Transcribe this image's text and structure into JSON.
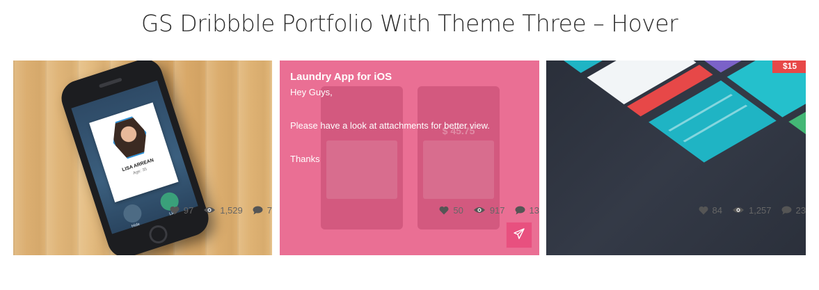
{
  "page": {
    "title": "GS Dribbble Portfolio With Theme Three – Hover"
  },
  "cards": [
    {
      "image": {
        "profile_name": "LISA ARREAN",
        "profile_age": "Age: 35",
        "hide_label": "Hide",
        "like_label": "Like"
      },
      "stats": {
        "likes": "97",
        "views": "1,529",
        "comments": "7"
      }
    },
    {
      "overlay": {
        "title": "Laundry App for iOS",
        "line1": "Hey Guys,",
        "line2": "Please have a look at attachments for better view.",
        "line3": "Thanks"
      },
      "image": {
        "price": "$ 45.75"
      },
      "stats": {
        "likes": "50",
        "views": "917",
        "comments": "13"
      }
    },
    {
      "image": {
        "top_price": "$15"
      },
      "stats": {
        "likes": "84",
        "views": "1,257",
        "comments": "23"
      }
    }
  ],
  "icons": {
    "likes": "heart-icon",
    "views": "eye-icon",
    "comments": "comment-icon",
    "share": "paper-plane-icon"
  },
  "colors": {
    "overlay_pink": "#ea6f94",
    "share_button": "#e8507f",
    "stat_text": "#666666",
    "title_text": "#2b2b2b"
  }
}
